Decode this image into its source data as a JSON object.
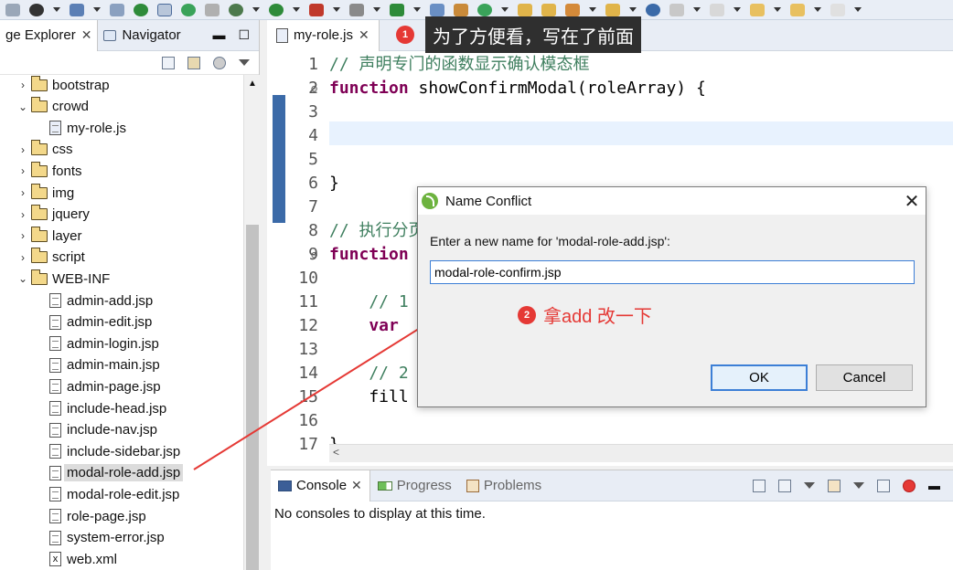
{
  "left_panel": {
    "tabs": [
      {
        "label": "ge Explorer"
      },
      {
        "label": "Navigator"
      }
    ],
    "tree": [
      {
        "label": "bootstrap",
        "type": "folder",
        "expanded": false
      },
      {
        "label": "crowd",
        "type": "folder",
        "expanded": true
      },
      {
        "label": "my-role.js",
        "type": "js"
      },
      {
        "label": "css",
        "type": "folder",
        "expanded": false
      },
      {
        "label": "fonts",
        "type": "folder",
        "expanded": false
      },
      {
        "label": "img",
        "type": "folder",
        "expanded": false
      },
      {
        "label": "jquery",
        "type": "folder",
        "expanded": false
      },
      {
        "label": "layer",
        "type": "folder",
        "expanded": false
      },
      {
        "label": "script",
        "type": "folder",
        "expanded": false
      },
      {
        "label": "WEB-INF",
        "type": "folder",
        "expanded": true
      },
      {
        "label": "admin-add.jsp",
        "type": "file"
      },
      {
        "label": "admin-edit.jsp",
        "type": "file"
      },
      {
        "label": "admin-login.jsp",
        "type": "file"
      },
      {
        "label": "admin-main.jsp",
        "type": "file"
      },
      {
        "label": "admin-page.jsp",
        "type": "file"
      },
      {
        "label": "include-head.jsp",
        "type": "file"
      },
      {
        "label": "include-nav.jsp",
        "type": "file"
      },
      {
        "label": "include-sidebar.jsp",
        "type": "file"
      },
      {
        "label": "modal-role-add.jsp",
        "type": "file",
        "selected": true
      },
      {
        "label": "modal-role-edit.jsp",
        "type": "file"
      },
      {
        "label": "role-page.jsp",
        "type": "file"
      },
      {
        "label": "system-error.jsp",
        "type": "file"
      },
      {
        "label": "web.xml",
        "type": "xml"
      }
    ]
  },
  "editor": {
    "tab_label": "my-role.js",
    "lines": [
      {
        "n": "1",
        "fold": "",
        "text": "// 声明专门的函数显示确认模态框",
        "kind": "comment"
      },
      {
        "n": "2",
        "fold": "⊖",
        "text": "function showConfirmModal(roleArray) {",
        "kind": "function"
      },
      {
        "n": "3",
        "fold": "",
        "text": "",
        "kind": "plain"
      },
      {
        "n": "4",
        "fold": "",
        "text": "",
        "kind": "plain"
      },
      {
        "n": "5",
        "fold": "",
        "text": "",
        "kind": "plain"
      },
      {
        "n": "6",
        "fold": "",
        "text": "}",
        "kind": "plain"
      },
      {
        "n": "7",
        "fold": "",
        "text": "",
        "kind": "plain"
      },
      {
        "n": "8",
        "fold": "",
        "text": "// 执行分页",
        "kind": "comment"
      },
      {
        "n": "9",
        "fold": "⊖",
        "text": "function",
        "kind": "keyword"
      },
      {
        "n": "10",
        "fold": "",
        "text": "",
        "kind": "plain"
      },
      {
        "n": "11",
        "fold": "",
        "text": "    // 1",
        "kind": "comment"
      },
      {
        "n": "12",
        "fold": "",
        "text": "    var",
        "kind": "keyword"
      },
      {
        "n": "13",
        "fold": "",
        "text": "",
        "kind": "plain"
      },
      {
        "n": "14",
        "fold": "",
        "text": "    // 2",
        "kind": "comment"
      },
      {
        "n": "15",
        "fold": "",
        "text": "    fill",
        "kind": "plain"
      },
      {
        "n": "16",
        "fold": "",
        "text": "",
        "kind": "plain"
      },
      {
        "n": "17",
        "fold": "",
        "text": "}",
        "kind": "plain"
      }
    ]
  },
  "annotation_1": {
    "number": "1",
    "text": "为了方便看，写在了前面"
  },
  "annotation_2": {
    "number": "2",
    "text": "拿add 改一下"
  },
  "dialog": {
    "title": "Name Conflict",
    "prompt": "Enter a new name for 'modal-role-add.jsp':",
    "input_value": "modal-role-confirm.jsp",
    "ok_label": "OK",
    "cancel_label": "Cancel"
  },
  "console": {
    "tabs": [
      {
        "label": "Console",
        "active": true
      },
      {
        "label": "Progress",
        "active": false
      },
      {
        "label": "Problems",
        "active": false
      }
    ],
    "message": "No consoles to display at this time."
  },
  "colors": {
    "accent": "#3c7fd6",
    "annotation_red": "#e53935",
    "keyword": "#7f0055",
    "comment": "#3f7f5f"
  }
}
